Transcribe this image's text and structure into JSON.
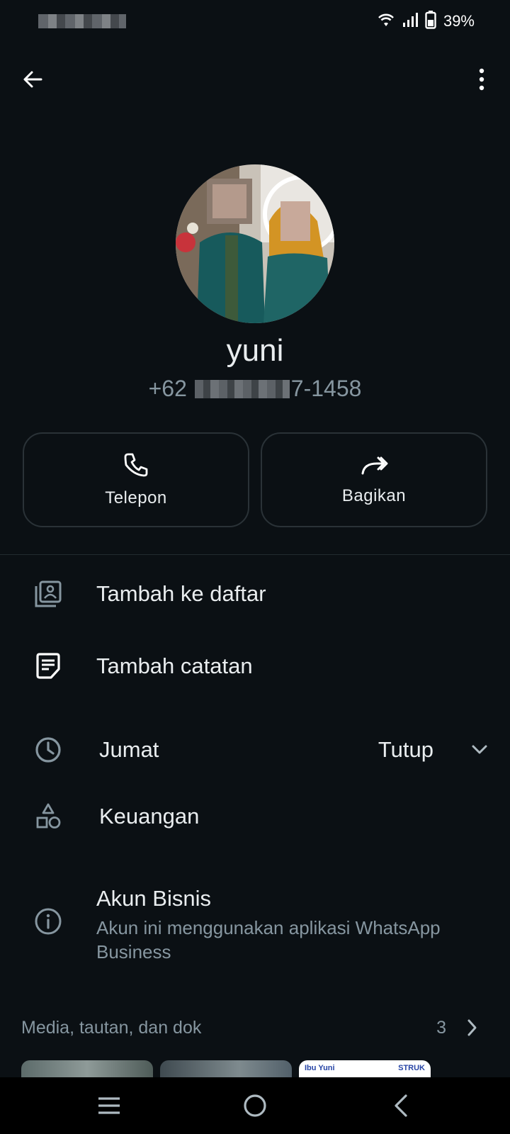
{
  "status_bar": {
    "battery": "39%",
    "icons": [
      "wifi-icon",
      "signal-icon",
      "battery-icon"
    ]
  },
  "header": {
    "back_icon": "arrow-left-icon",
    "menu_icon": "more-vert-icon"
  },
  "profile": {
    "name": "yuni",
    "phone_prefix": "+62",
    "phone_suffix": "7-1458"
  },
  "actions": [
    {
      "label": "Telepon",
      "icon": "phone-icon"
    },
    {
      "label": "Bagikan",
      "icon": "share-icon"
    }
  ],
  "list": {
    "add_to_list": "Tambah ke daftar",
    "add_note": "Tambah catatan",
    "hours_day": "Jumat",
    "hours_status": "Tutup",
    "category": "Keuangan",
    "business_title": "Akun Bisnis",
    "business_desc": "Akun ini menggunakan aplikasi WhatsApp Business"
  },
  "media": {
    "title": "Media, tautan, dan dok",
    "count": "3",
    "thumb3_left": "Ibu Yuni",
    "thumb3_right": "STRUK"
  },
  "colors": {
    "background": "#0b1014",
    "text_primary": "#e9edef",
    "text_secondary": "#8696a0"
  }
}
